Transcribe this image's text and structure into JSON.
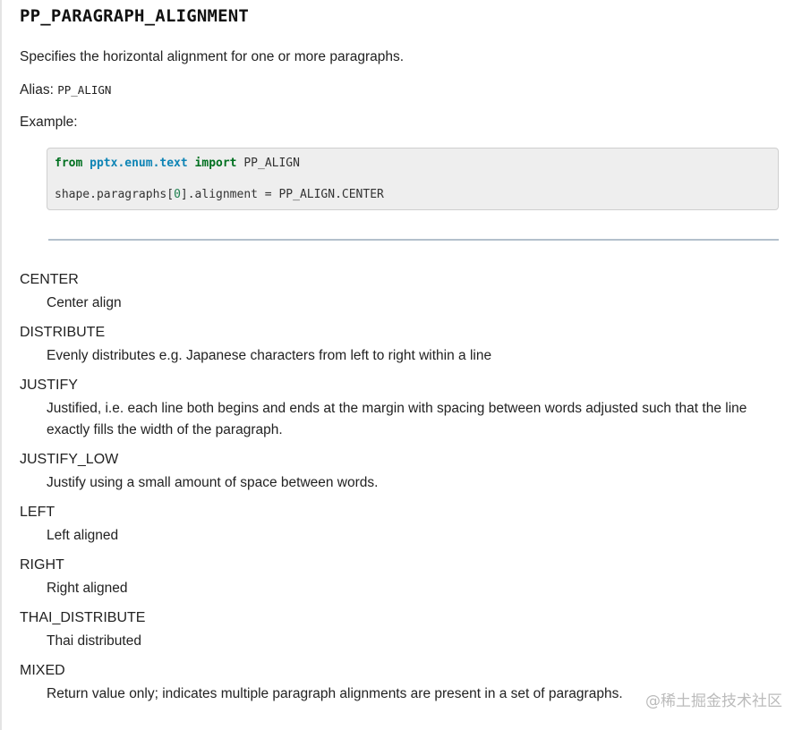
{
  "title": "PP_PARAGRAPH_ALIGNMENT",
  "description": "Specifies the horizontal alignment for one or more paragraphs.",
  "alias": {
    "label": "Alias:",
    "value": "PP_ALIGN"
  },
  "example_label": "Example:",
  "code": {
    "line1": {
      "kw_from": "from",
      "module": "pptx.enum.text",
      "kw_import": "import",
      "name": "PP_ALIGN"
    },
    "line2": {
      "prefix": "shape.paragraphs[",
      "index": "0",
      "suffix": "].alignment = PP_ALIGN.CENTER"
    }
  },
  "members": [
    {
      "name": "CENTER",
      "description": "Center align"
    },
    {
      "name": "DISTRIBUTE",
      "description": "Evenly distributes e.g. Japanese characters from left to right within a line"
    },
    {
      "name": "JUSTIFY",
      "description": "Justified, i.e. each line both begins and ends at the margin with spacing between words adjusted such that the line exactly fills the width of the paragraph."
    },
    {
      "name": "JUSTIFY_LOW",
      "description": "Justify using a small amount of space between words."
    },
    {
      "name": "LEFT",
      "description": "Left aligned"
    },
    {
      "name": "RIGHT",
      "description": "Right aligned"
    },
    {
      "name": "THAI_DISTRIBUTE",
      "description": "Thai distributed"
    },
    {
      "name": "MIXED",
      "description": "Return value only; indicates multiple paragraph alignments are present in a set of paragraphs."
    }
  ],
  "watermark": "@稀土掘金技术社区",
  "colors": {
    "keyword": "#007020",
    "module": "#0e84b5",
    "number": "#208050",
    "code_bg": "#eeeeee",
    "divider": "#b3c0cc"
  }
}
